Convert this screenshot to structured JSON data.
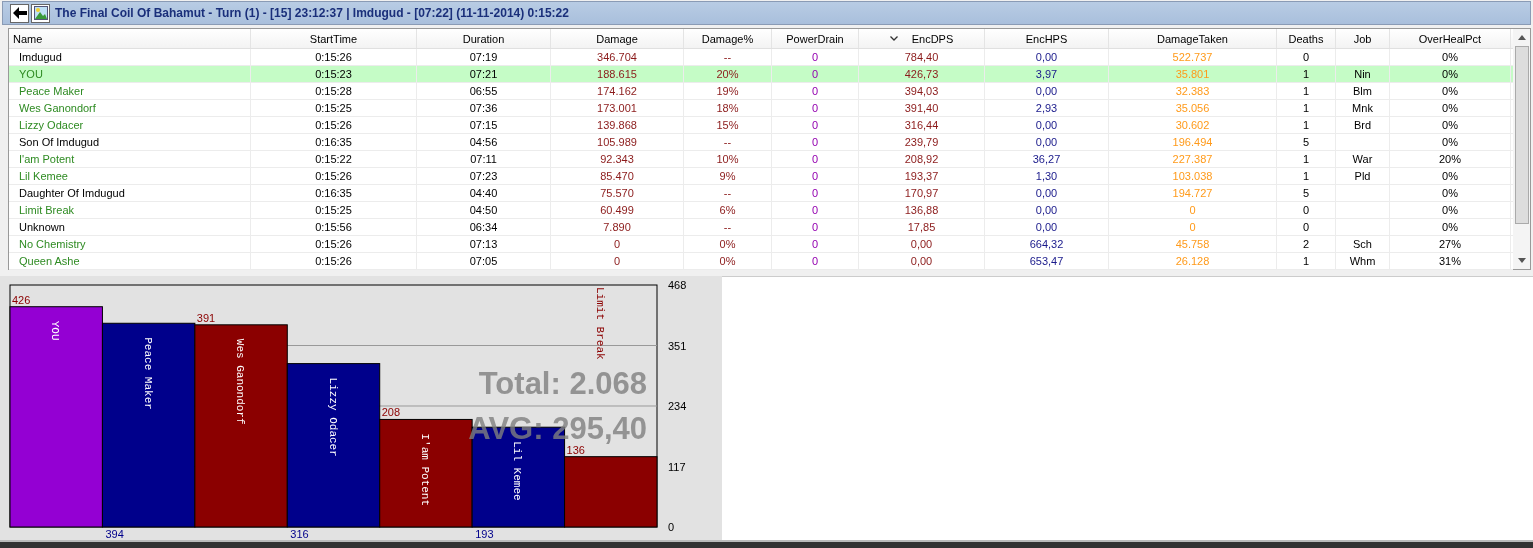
{
  "window": {
    "title": "The Final Coil Of Bahamut - Turn (1) - [15] 23:12:37 | Imdugud - [07:22] (11-11-2014) 0:15:22"
  },
  "table": {
    "columns": [
      {
        "label": "Name",
        "sorted": false
      },
      {
        "label": "StartTime",
        "sorted": false
      },
      {
        "label": "Duration",
        "sorted": false
      },
      {
        "label": "Damage",
        "sorted": false
      },
      {
        "label": "Damage%",
        "sorted": false
      },
      {
        "label": "PowerDrain",
        "sorted": false
      },
      {
        "label": "EncDPS",
        "sorted": true
      },
      {
        "label": "EncHPS",
        "sorted": false
      },
      {
        "label": "DamageTaken",
        "sorted": false
      },
      {
        "label": "Deaths",
        "sorted": false
      },
      {
        "label": "Job",
        "sorted": false
      },
      {
        "label": "OverHealPct",
        "sorted": false
      }
    ],
    "rows": [
      {
        "kind": "enemy",
        "selected": false,
        "cells": [
          "Imdugud",
          "0:15:26",
          "07:19",
          "346.704",
          "--",
          "0",
          "784,40",
          "0,00",
          "522.737",
          "0",
          "",
          "0%"
        ]
      },
      {
        "kind": "ally",
        "selected": true,
        "cells": [
          "YOU",
          "0:15:23",
          "07:21",
          "188.615",
          "20%",
          "0",
          "426,73",
          "3,97",
          "35.801",
          "1",
          "Nin",
          "0%"
        ]
      },
      {
        "kind": "ally",
        "selected": false,
        "cells": [
          "Peace Maker",
          "0:15:28",
          "06:55",
          "174.162",
          "19%",
          "0",
          "394,03",
          "0,00",
          "32.383",
          "1",
          "Blm",
          "0%"
        ]
      },
      {
        "kind": "ally",
        "selected": false,
        "cells": [
          "Wes Ganondorf",
          "0:15:25",
          "07:36",
          "173.001",
          "18%",
          "0",
          "391,40",
          "2,93",
          "35.056",
          "1",
          "Mnk",
          "0%"
        ]
      },
      {
        "kind": "ally",
        "selected": false,
        "cells": [
          "Lizzy Odacer",
          "0:15:26",
          "07:15",
          "139.868",
          "15%",
          "0",
          "316,44",
          "0,00",
          "30.602",
          "1",
          "Brd",
          "0%"
        ]
      },
      {
        "kind": "enemy",
        "selected": false,
        "cells": [
          "Son Of Imdugud",
          "0:16:35",
          "04:56",
          "105.989",
          "--",
          "0",
          "239,79",
          "0,00",
          "196.494",
          "5",
          "",
          "0%"
        ]
      },
      {
        "kind": "ally",
        "selected": false,
        "cells": [
          "I'am Potent",
          "0:15:22",
          "07:11",
          "92.343",
          "10%",
          "0",
          "208,92",
          "36,27",
          "227.387",
          "1",
          "War",
          "20%"
        ]
      },
      {
        "kind": "ally",
        "selected": false,
        "cells": [
          "Lil Kemee",
          "0:15:26",
          "07:23",
          "85.470",
          "9%",
          "0",
          "193,37",
          "1,30",
          "103.038",
          "1",
          "Pld",
          "0%"
        ]
      },
      {
        "kind": "enemy",
        "selected": false,
        "cells": [
          "Daughter Of Imdugud",
          "0:16:35",
          "04:40",
          "75.570",
          "--",
          "0",
          "170,97",
          "0,00",
          "194.727",
          "5",
          "",
          "0%"
        ]
      },
      {
        "kind": "ally",
        "selected": false,
        "cells": [
          "Limit Break",
          "0:15:25",
          "04:50",
          "60.499",
          "6%",
          "0",
          "136,88",
          "0,00",
          "0",
          "0",
          "",
          "0%"
        ]
      },
      {
        "kind": "enemy",
        "selected": false,
        "cells": [
          "Unknown",
          "0:15:56",
          "06:34",
          "7.890",
          "--",
          "0",
          "17,85",
          "0,00",
          "0",
          "0",
          "",
          "0%"
        ]
      },
      {
        "kind": "ally",
        "selected": false,
        "cells": [
          "No Chemistry",
          "0:15:26",
          "07:13",
          "0",
          "0%",
          "0",
          "0,00",
          "664,32",
          "45.758",
          "2",
          "Sch",
          "27%"
        ]
      },
      {
        "kind": "ally",
        "selected": false,
        "cells": [
          "Queen Ashe",
          "0:15:26",
          "07:05",
          "0",
          "0%",
          "0",
          "0,00",
          "653,47",
          "26.128",
          "1",
          "Whm",
          "31%"
        ]
      }
    ]
  },
  "chart": {
    "chart_data": {
      "type": "bar",
      "categories": [
        "YOU",
        "Peace Maker",
        "Wes Ganondorf",
        "Lizzy Odacer",
        "I'am Potent",
        "Lil Kemee",
        "Limit Break"
      ],
      "values": [
        426,
        394,
        391,
        316,
        208,
        193,
        136
      ],
      "colors": [
        "#9400d3",
        "#00008b",
        "#8b0000",
        "#00008b",
        "#8b0000",
        "#00008b",
        "#8b0000"
      ],
      "value_labels": [
        "426",
        "394",
        "391",
        "316",
        "208",
        "193",
        "136"
      ],
      "ylim": [
        0,
        468
      ],
      "yticks": [
        0,
        117,
        234,
        351,
        468
      ],
      "annotations": [
        "Total: 2.068",
        "AVG: 295,40"
      ]
    }
  }
}
